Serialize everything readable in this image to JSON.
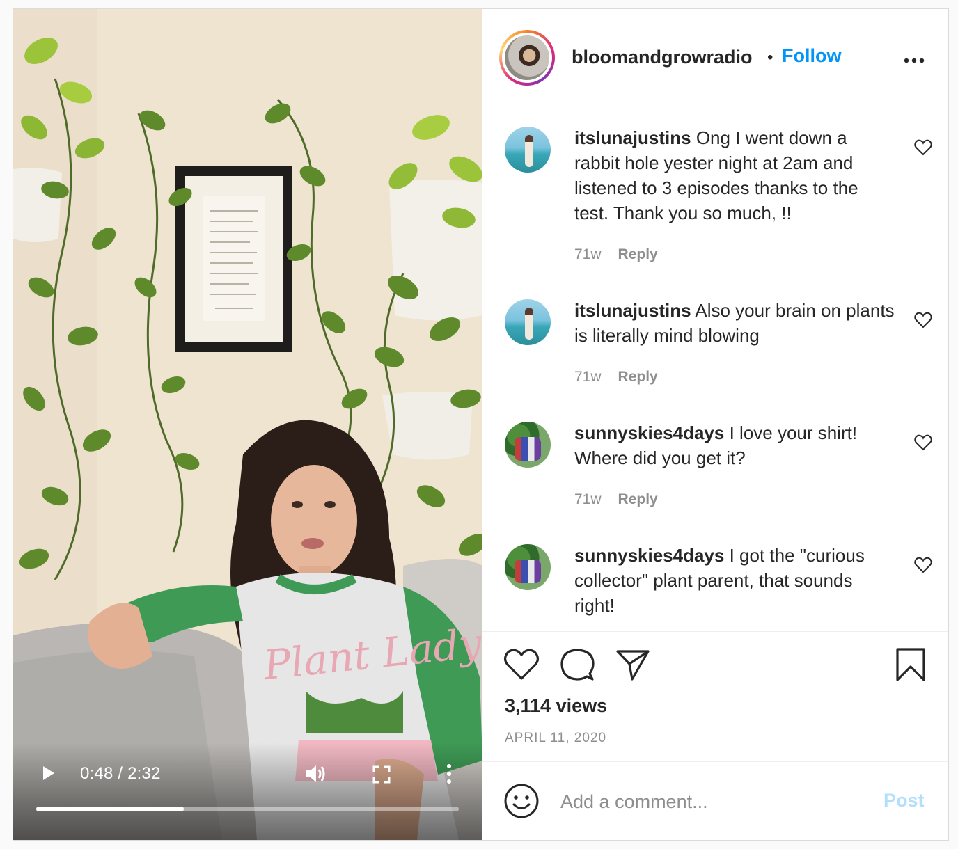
{
  "author": {
    "username": "bloomandgrowradio",
    "separator": "•",
    "follow_label": "Follow",
    "options_icon": "more-horizontal-icon"
  },
  "video": {
    "play_icon": "play-icon",
    "time_label": "0:48 / 2:32",
    "volume_icon": "volume-icon",
    "fullscreen_icon": "fullscreen-icon",
    "more_icon": "more-vertical-icon",
    "progress_fraction": 0.35
  },
  "comments": [
    {
      "username": "itslunajustins",
      "text": "Ong I went down a rabbit hole yester night at 2am and listened to 3 episodes thanks to the test. Thank you so much, !!",
      "age": "71w",
      "reply_label": "Reply"
    },
    {
      "username": "itslunajustins",
      "text": "Also your brain on plants is literally mind blowing",
      "age": "71w",
      "reply_label": "Reply"
    },
    {
      "username": "sunnyskies4days",
      "text": "I love your shirt! Where did you get it?",
      "age": "71w",
      "reply_label": "Reply"
    },
    {
      "username": "sunnyskies4days",
      "text": "I got the \"curious collector\" plant parent, that sounds right!",
      "age": "",
      "reply_label": ""
    }
  ],
  "actions": {
    "like_icon": "heart-icon",
    "comment_icon": "comment-icon",
    "share_icon": "send-icon",
    "save_icon": "bookmark-icon"
  },
  "stats": {
    "views": "3,114 views",
    "date": "APRIL 11, 2020"
  },
  "composer": {
    "emoji_icon": "emoji-icon",
    "placeholder": "Add a comment...",
    "post_label": "Post"
  },
  "colors": {
    "accent": "#0095f6",
    "post_disabled": "#b2dffc",
    "muted": "#8e8e8e",
    "text": "#262626",
    "border": "#dbdbdb"
  }
}
